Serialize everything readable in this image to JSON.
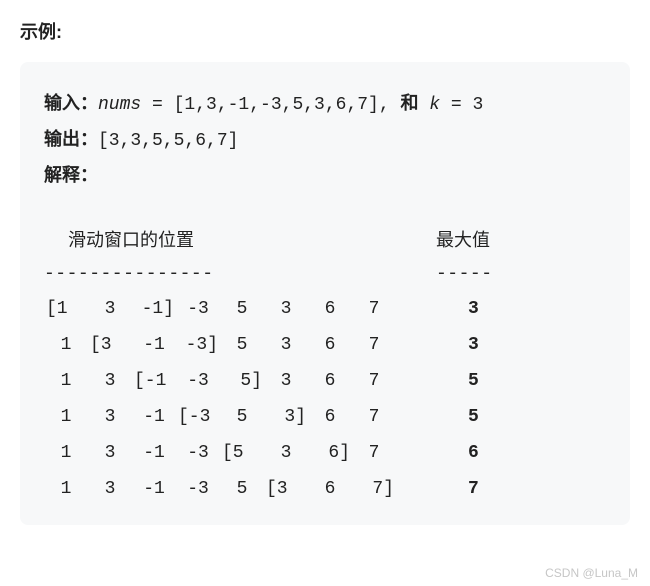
{
  "title": "示例:",
  "labels": {
    "input": "输入：",
    "output": "输出：",
    "explain": "解释：",
    "nums_var": "nums",
    "k_var": "k",
    "and": "和",
    "eq": " = ",
    "comma": ", "
  },
  "input_value": "[1,3,-1,-3,5,3,6,7]",
  "k_value": "3",
  "output_value": "[3,3,5,5,6,7]",
  "headers": {
    "position": "滑动窗口的位置",
    "max": "最大值"
  },
  "divider": {
    "pos": "---------------",
    "max": "-----"
  },
  "rows": [
    {
      "values": [
        1,
        3,
        -1,
        -3,
        5,
        3,
        6,
        7
      ],
      "window": [
        0,
        2
      ],
      "max": 3
    },
    {
      "values": [
        1,
        3,
        -1,
        -3,
        5,
        3,
        6,
        7
      ],
      "window": [
        1,
        3
      ],
      "max": 3
    },
    {
      "values": [
        1,
        3,
        -1,
        -3,
        5,
        3,
        6,
        7
      ],
      "window": [
        2,
        4
      ],
      "max": 5
    },
    {
      "values": [
        1,
        3,
        -1,
        -3,
        5,
        3,
        6,
        7
      ],
      "window": [
        3,
        5
      ],
      "max": 5
    },
    {
      "values": [
        1,
        3,
        -1,
        -3,
        5,
        3,
        6,
        7
      ],
      "window": [
        4,
        6
      ],
      "max": 6
    },
    {
      "values": [
        1,
        3,
        -1,
        -3,
        5,
        3,
        6,
        7
      ],
      "window": [
        5,
        7
      ],
      "max": 7
    }
  ],
  "watermark": "CSDN @Luna_M",
  "chart_data": {
    "type": "table",
    "title": "Sliding window maximum, k = 3",
    "columns": [
      "window_position",
      "max"
    ],
    "data": [
      {
        "window_position": "[1 3 -1] -3 5 3 6 7",
        "max": 3
      },
      {
        "window_position": "1 [3 -1 -3] 5 3 6 7",
        "max": 3
      },
      {
        "window_position": "1 3 [-1 -3 5] 3 6 7",
        "max": 5
      },
      {
        "window_position": "1 3 -1 [-3 5 3] 6 7",
        "max": 5
      },
      {
        "window_position": "1 3 -1 -3 [5 3 6] 7",
        "max": 6
      },
      {
        "window_position": "1 3 -1 -3 5 [3 6 7]",
        "max": 7
      }
    ]
  }
}
